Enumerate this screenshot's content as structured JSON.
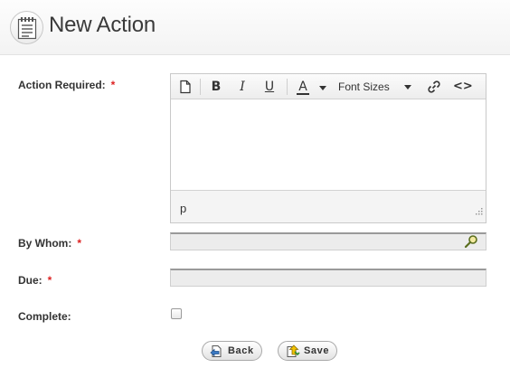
{
  "header": {
    "title": "New Action",
    "icon": "notepad-icon"
  },
  "form": {
    "action_required": {
      "label": "Action Required:",
      "required_mark": "*"
    },
    "by_whom": {
      "label": "By Whom:",
      "required_mark": "*",
      "value": ""
    },
    "due": {
      "label": "Due:",
      "required_mark": "*",
      "value": ""
    },
    "complete": {
      "label": "Complete:",
      "checked": false
    }
  },
  "editor": {
    "toolbar": {
      "new_document": "new-document-icon",
      "bold": "B",
      "italic": "I",
      "underline": "U",
      "text_color": "A",
      "font_sizes": "Font Sizes",
      "link": "link-icon",
      "source": "<>"
    },
    "content": "",
    "status_path": "p"
  },
  "buttons": {
    "back": "Back",
    "save": "Save"
  },
  "colors": {
    "required": "#dd2222",
    "input_bg": "#ececec",
    "header_bg": "#f6f6f6"
  }
}
